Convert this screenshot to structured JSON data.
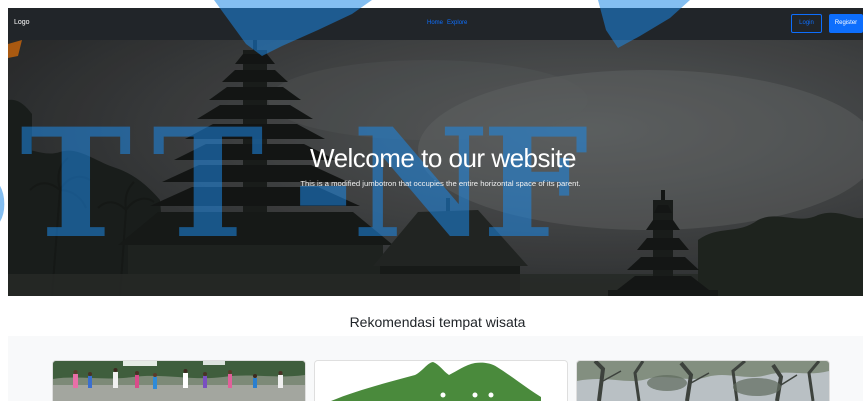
{
  "navbar": {
    "brand": "Logo",
    "links": [
      {
        "label": "Home"
      },
      {
        "label": "Explore"
      }
    ],
    "login_label": "Login",
    "register_label": "Register"
  },
  "hero": {
    "title": "Welcome to our website",
    "subtitle": "This is a modified jumbotron that occupies the entire horizontal space of its parent."
  },
  "recommendations": {
    "heading": "Rekomendasi tempat wisata"
  },
  "watermark": {
    "text": "STT-NF"
  },
  "colors": {
    "navbar_bg": "#212529",
    "primary": "#0d6efd",
    "section_bg": "#f8f9fa",
    "hero_text": "#ffffff",
    "watermark": "#1e88e5",
    "leaf_green": "#4a8a3c"
  }
}
